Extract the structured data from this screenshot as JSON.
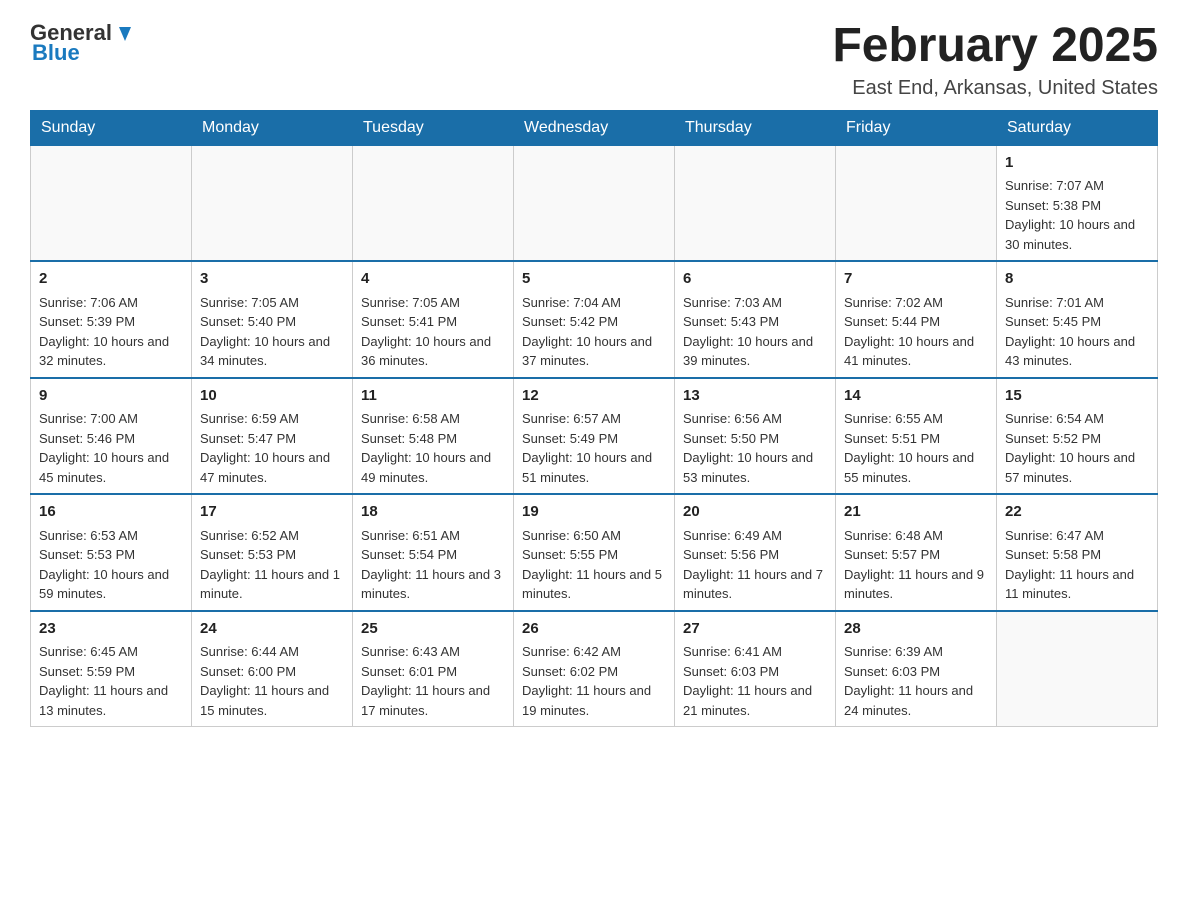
{
  "header": {
    "logo_general": "General",
    "logo_blue": "Blue",
    "title": "February 2025",
    "subtitle": "East End, Arkansas, United States"
  },
  "days_of_week": [
    "Sunday",
    "Monday",
    "Tuesday",
    "Wednesday",
    "Thursday",
    "Friday",
    "Saturday"
  ],
  "weeks": [
    [
      {
        "day": "",
        "info": ""
      },
      {
        "day": "",
        "info": ""
      },
      {
        "day": "",
        "info": ""
      },
      {
        "day": "",
        "info": ""
      },
      {
        "day": "",
        "info": ""
      },
      {
        "day": "",
        "info": ""
      },
      {
        "day": "1",
        "info": "Sunrise: 7:07 AM\nSunset: 5:38 PM\nDaylight: 10 hours and 30 minutes."
      }
    ],
    [
      {
        "day": "2",
        "info": "Sunrise: 7:06 AM\nSunset: 5:39 PM\nDaylight: 10 hours and 32 minutes."
      },
      {
        "day": "3",
        "info": "Sunrise: 7:05 AM\nSunset: 5:40 PM\nDaylight: 10 hours and 34 minutes."
      },
      {
        "day": "4",
        "info": "Sunrise: 7:05 AM\nSunset: 5:41 PM\nDaylight: 10 hours and 36 minutes."
      },
      {
        "day": "5",
        "info": "Sunrise: 7:04 AM\nSunset: 5:42 PM\nDaylight: 10 hours and 37 minutes."
      },
      {
        "day": "6",
        "info": "Sunrise: 7:03 AM\nSunset: 5:43 PM\nDaylight: 10 hours and 39 minutes."
      },
      {
        "day": "7",
        "info": "Sunrise: 7:02 AM\nSunset: 5:44 PM\nDaylight: 10 hours and 41 minutes."
      },
      {
        "day": "8",
        "info": "Sunrise: 7:01 AM\nSunset: 5:45 PM\nDaylight: 10 hours and 43 minutes."
      }
    ],
    [
      {
        "day": "9",
        "info": "Sunrise: 7:00 AM\nSunset: 5:46 PM\nDaylight: 10 hours and 45 minutes."
      },
      {
        "day": "10",
        "info": "Sunrise: 6:59 AM\nSunset: 5:47 PM\nDaylight: 10 hours and 47 minutes."
      },
      {
        "day": "11",
        "info": "Sunrise: 6:58 AM\nSunset: 5:48 PM\nDaylight: 10 hours and 49 minutes."
      },
      {
        "day": "12",
        "info": "Sunrise: 6:57 AM\nSunset: 5:49 PM\nDaylight: 10 hours and 51 minutes."
      },
      {
        "day": "13",
        "info": "Sunrise: 6:56 AM\nSunset: 5:50 PM\nDaylight: 10 hours and 53 minutes."
      },
      {
        "day": "14",
        "info": "Sunrise: 6:55 AM\nSunset: 5:51 PM\nDaylight: 10 hours and 55 minutes."
      },
      {
        "day": "15",
        "info": "Sunrise: 6:54 AM\nSunset: 5:52 PM\nDaylight: 10 hours and 57 minutes."
      }
    ],
    [
      {
        "day": "16",
        "info": "Sunrise: 6:53 AM\nSunset: 5:53 PM\nDaylight: 10 hours and 59 minutes."
      },
      {
        "day": "17",
        "info": "Sunrise: 6:52 AM\nSunset: 5:53 PM\nDaylight: 11 hours and 1 minute."
      },
      {
        "day": "18",
        "info": "Sunrise: 6:51 AM\nSunset: 5:54 PM\nDaylight: 11 hours and 3 minutes."
      },
      {
        "day": "19",
        "info": "Sunrise: 6:50 AM\nSunset: 5:55 PM\nDaylight: 11 hours and 5 minutes."
      },
      {
        "day": "20",
        "info": "Sunrise: 6:49 AM\nSunset: 5:56 PM\nDaylight: 11 hours and 7 minutes."
      },
      {
        "day": "21",
        "info": "Sunrise: 6:48 AM\nSunset: 5:57 PM\nDaylight: 11 hours and 9 minutes."
      },
      {
        "day": "22",
        "info": "Sunrise: 6:47 AM\nSunset: 5:58 PM\nDaylight: 11 hours and 11 minutes."
      }
    ],
    [
      {
        "day": "23",
        "info": "Sunrise: 6:45 AM\nSunset: 5:59 PM\nDaylight: 11 hours and 13 minutes."
      },
      {
        "day": "24",
        "info": "Sunrise: 6:44 AM\nSunset: 6:00 PM\nDaylight: 11 hours and 15 minutes."
      },
      {
        "day": "25",
        "info": "Sunrise: 6:43 AM\nSunset: 6:01 PM\nDaylight: 11 hours and 17 minutes."
      },
      {
        "day": "26",
        "info": "Sunrise: 6:42 AM\nSunset: 6:02 PM\nDaylight: 11 hours and 19 minutes."
      },
      {
        "day": "27",
        "info": "Sunrise: 6:41 AM\nSunset: 6:03 PM\nDaylight: 11 hours and 21 minutes."
      },
      {
        "day": "28",
        "info": "Sunrise: 6:39 AM\nSunset: 6:03 PM\nDaylight: 11 hours and 24 minutes."
      },
      {
        "day": "",
        "info": ""
      }
    ]
  ]
}
